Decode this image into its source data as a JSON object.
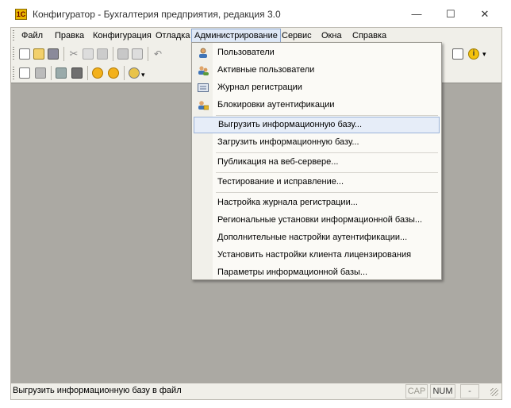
{
  "window": {
    "title": "Конфигуратор - Бухгалтерия предприятия, редакция 3.0",
    "minimize_glyph": "—",
    "maximize_glyph": "☐",
    "close_glyph": "✕"
  },
  "menubar": {
    "items": [
      {
        "label": "Файл"
      },
      {
        "label": "Правка"
      },
      {
        "label": "Конфигурация"
      },
      {
        "label": "Отладка"
      },
      {
        "label": "Администрирование"
      },
      {
        "label": "Сервис"
      },
      {
        "label": "Окна"
      },
      {
        "label": "Справка"
      }
    ]
  },
  "admin_menu": {
    "items": [
      {
        "label": "Пользователи",
        "icon": "user-icon"
      },
      {
        "label": "Активные пользователи",
        "icon": "active-users-icon"
      },
      {
        "label": "Журнал регистрации",
        "icon": "log-icon"
      },
      {
        "label": "Блокировки аутентификации",
        "icon": "lock-user-icon"
      },
      {
        "label": "Выгрузить информационную базу...",
        "icon": ""
      },
      {
        "label": "Загрузить информационную базу...",
        "icon": ""
      },
      {
        "label": "Публикация на веб-сервере...",
        "icon": ""
      },
      {
        "label": "Тестирование и исправление...",
        "icon": ""
      },
      {
        "label": "Настройка журнала регистрации...",
        "icon": ""
      },
      {
        "label": "Региональные установки информационной базы...",
        "icon": ""
      },
      {
        "label": "Дополнительные настройки аутентификации...",
        "icon": ""
      },
      {
        "label": "Установить настройки клиента лицензирования",
        "icon": ""
      },
      {
        "label": "Параметры информационной базы...",
        "icon": ""
      }
    ],
    "highlighted_index": 4
  },
  "statusbar": {
    "text": "Выгрузить информационную базу в файл",
    "cap": "CAP",
    "num": "NUM",
    "dropdown_glyph": "-"
  },
  "colors": {
    "menu_highlight": "#e6edf8",
    "workarea": "#aba9a3",
    "app_icon": "#e9b800"
  }
}
